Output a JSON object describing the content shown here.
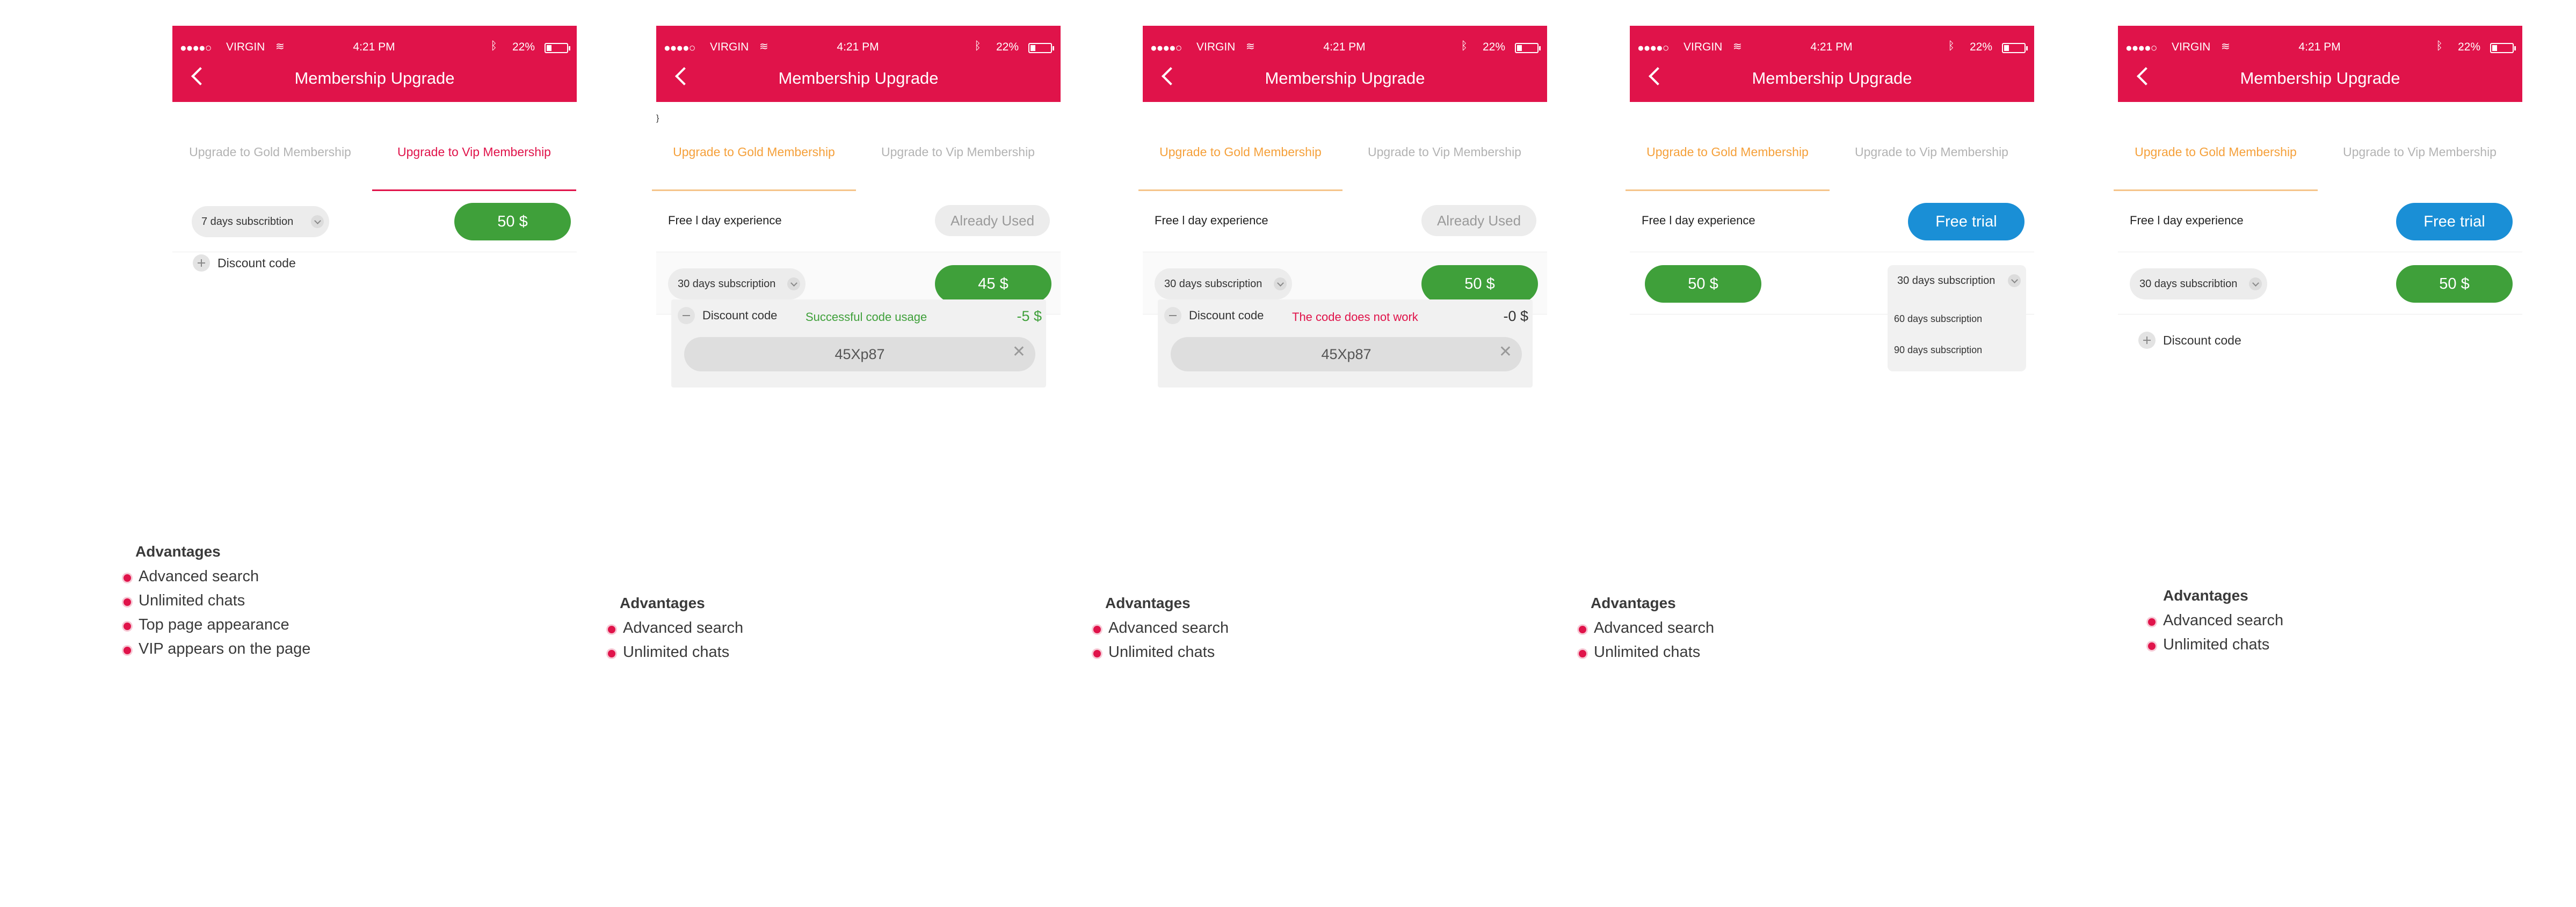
{
  "colors": {
    "brand": "#e0134a",
    "gold_tab": "#f5a03a",
    "price_green": "#3fa03a",
    "trial_blue": "#1a8fd6",
    "success_text": "#3fa03a",
    "error_text": "#e0134a"
  },
  "status_bar": {
    "signal": "●●●●○",
    "carrier": "VIRGIN",
    "wifi": "wifi-icon",
    "time": "4:21 PM",
    "bluetooth": "ᛒ",
    "battery": "22%"
  },
  "nav": {
    "title": "Membership Upgrade"
  },
  "tabs": {
    "gold": "Upgrade to Gold Membership",
    "vip": "Upgrade to Vip Membership"
  },
  "screens": [
    {
      "active_tab": "vip",
      "subscription": "7 days subscribtion",
      "price": "50 $",
      "discount_label": "Discount code"
    },
    {
      "active_tab": "gold",
      "free_label": "Free  l  day experience",
      "free_button": "Already Used",
      "subscription": "30 days subscription",
      "price": "45 $",
      "discount_label": "Discount code",
      "discount_message": "Successful code usage",
      "discount_amount": "-5 $",
      "discount_code": "45Xp87"
    },
    {
      "active_tab": "gold",
      "free_label": "Free  l  day experience",
      "free_button": "Already Used",
      "subscription": "30 days subscription",
      "price": "50 $",
      "discount_label": "Discount code",
      "discount_message": "The code does not work",
      "discount_amount": "-0 $",
      "discount_code": "45Xp87"
    },
    {
      "active_tab": "gold",
      "free_label": "Free  l  day experience",
      "free_button": "Free trial",
      "price": "50 $",
      "subscription": "30 days subscription",
      "dropdown_options": [
        "60 days subscription",
        "90 days subscription"
      ]
    },
    {
      "active_tab": "gold",
      "free_label": "Free  l  day experience",
      "free_button": "Free trial",
      "subscription": "30 days subscribtion",
      "price": "50 $",
      "discount_label": "Discount code"
    }
  ],
  "advantages": [
    {
      "title": "Advantages",
      "items": [
        "Advanced search",
        "Unlimited chats",
        "Top page appearance",
        "VIP appears on the page"
      ]
    },
    {
      "title": "Advantages",
      "items": [
        "Advanced search",
        "Unlimited chats"
      ]
    },
    {
      "title": "Advantages",
      "items": [
        "Advanced search",
        "Unlimited chats"
      ]
    },
    {
      "title": "Advantages",
      "items": [
        "Advanced search",
        "Unlimited chats"
      ]
    },
    {
      "title": "Advantages",
      "items": [
        "Advanced search",
        "Unlimited chats"
      ]
    }
  ]
}
